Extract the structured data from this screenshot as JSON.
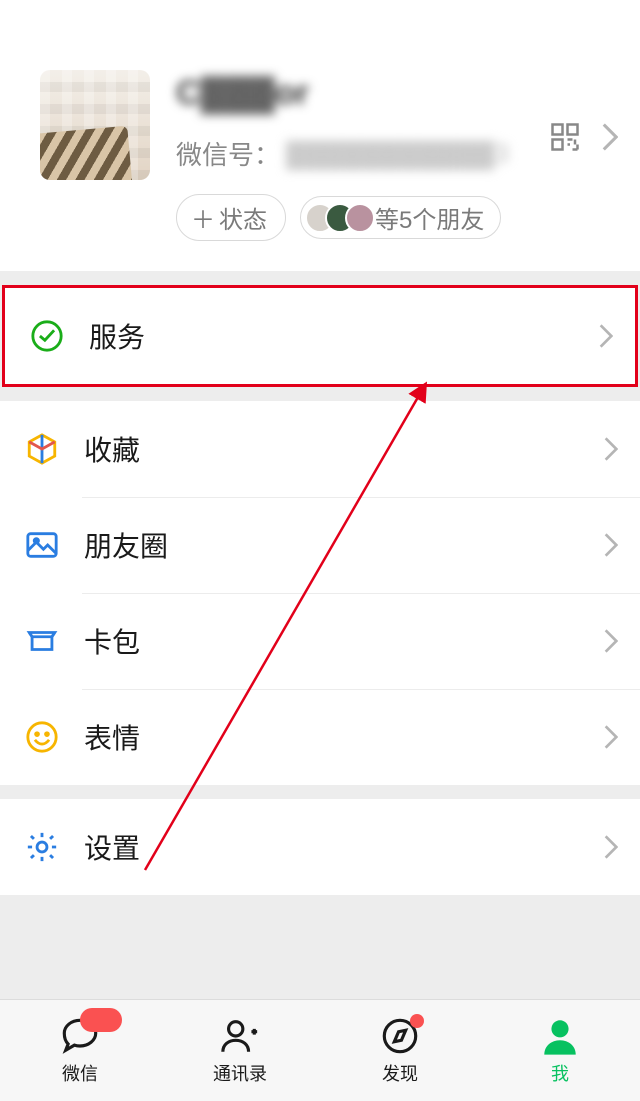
{
  "profile": {
    "nickname_display": "C▓▓▓or",
    "wx_label": "微信号：",
    "wx_id_display": "▓▓▓▓▓▓▓▓▓▓▓3",
    "status_btn": "状态",
    "friends_text": "等5个朋友"
  },
  "menu": {
    "services": "服务",
    "favorites": "收藏",
    "moments": "朋友圈",
    "cards": "卡包",
    "stickers": "表情",
    "settings": "设置"
  },
  "tabs": {
    "chat": "微信",
    "contacts": "通讯录",
    "discover": "发现",
    "me": "我"
  },
  "annotation": {
    "highlighted_row": "services"
  }
}
